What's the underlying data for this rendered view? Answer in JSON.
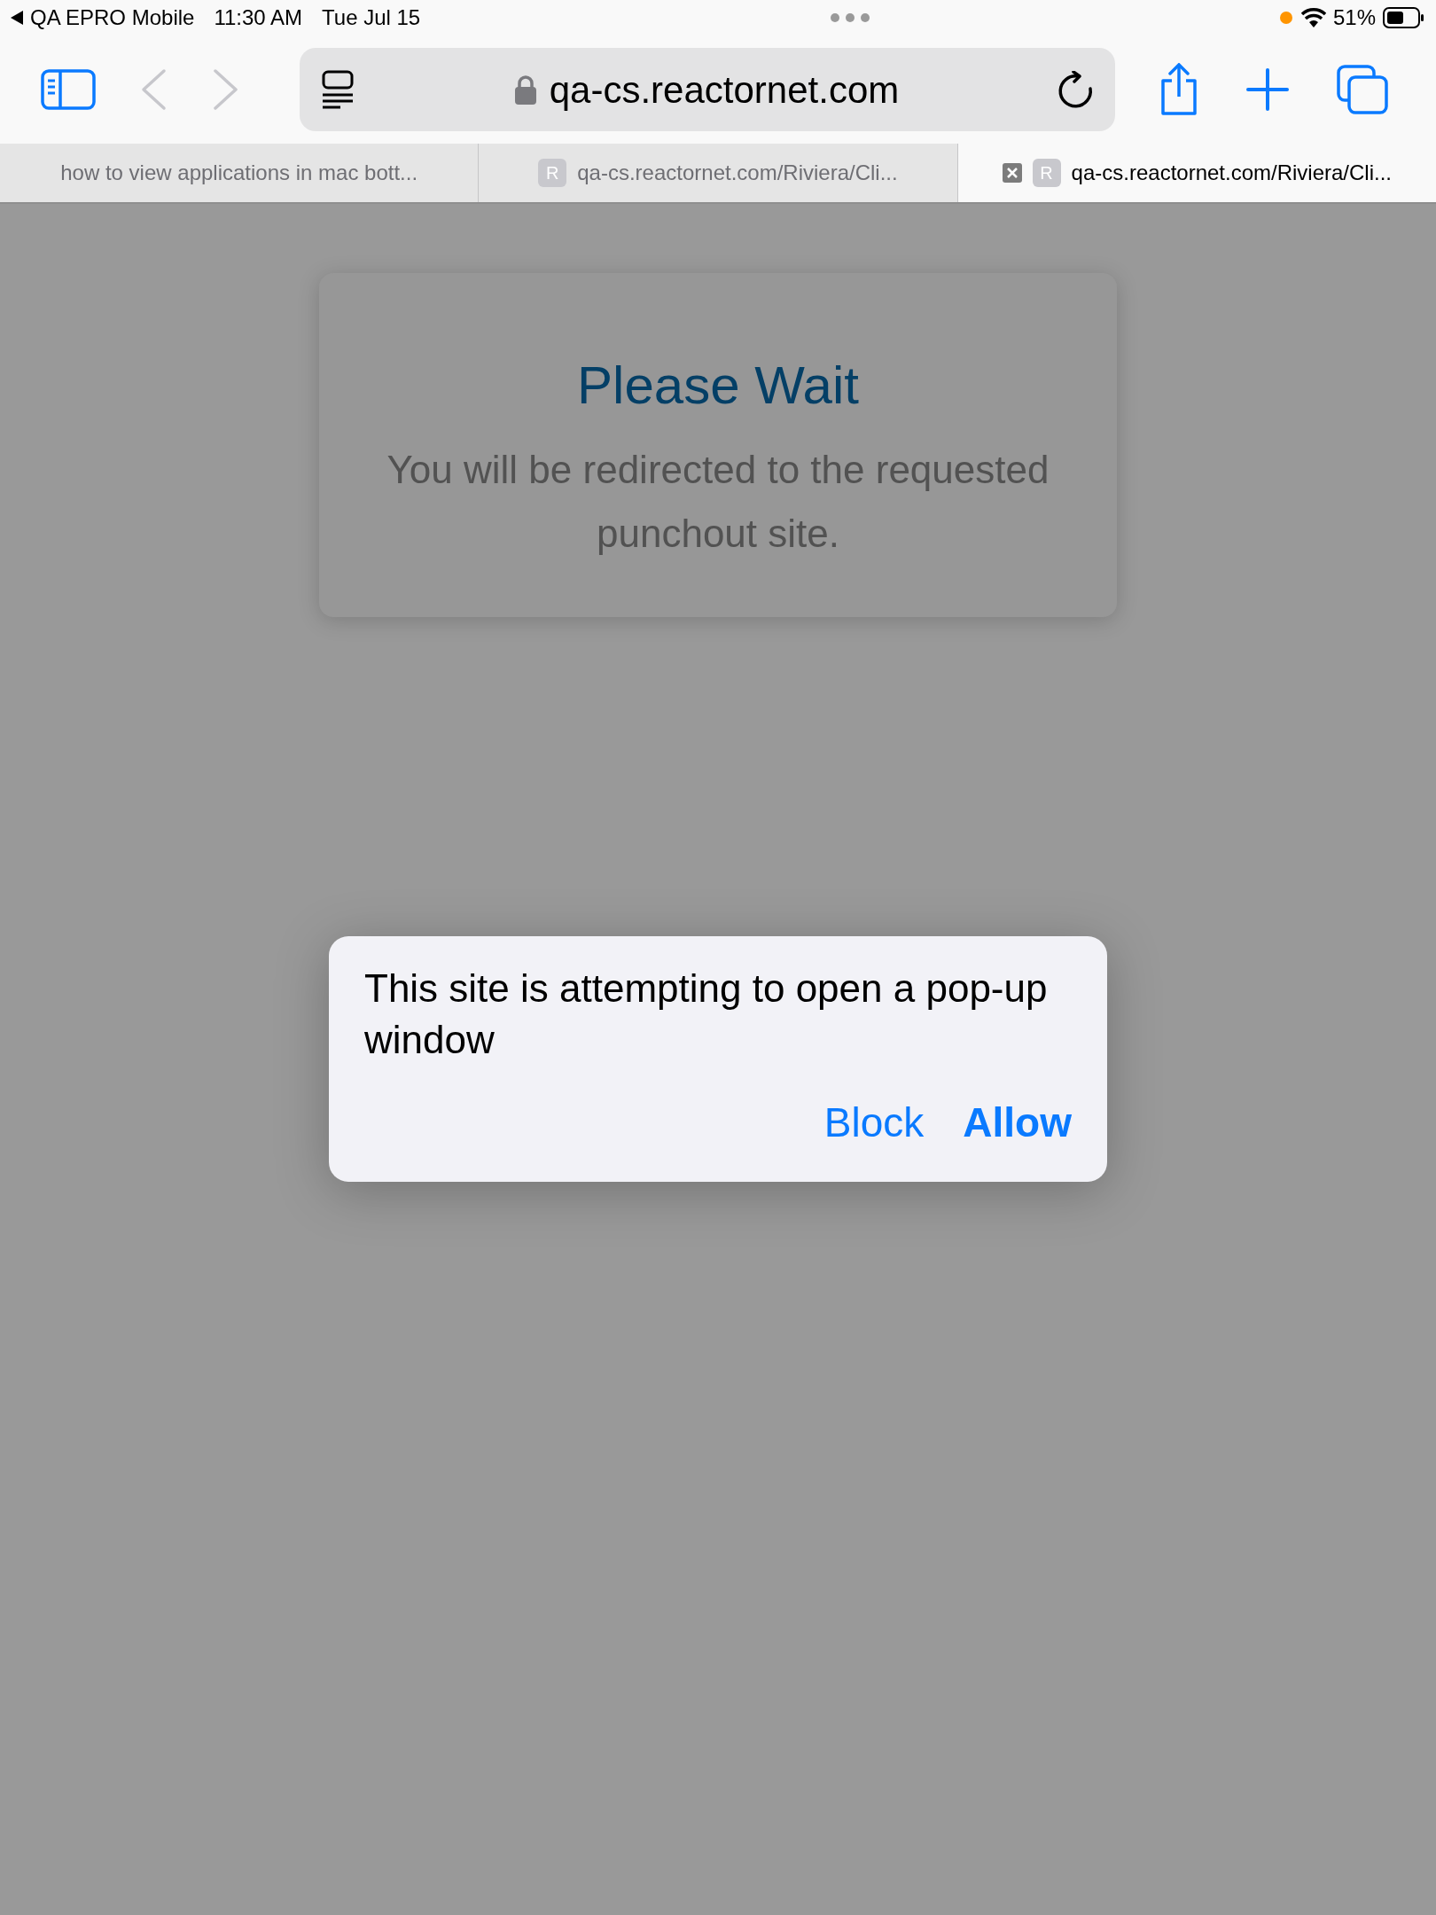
{
  "status_bar": {
    "back_app": "QA EPRO Mobile",
    "time": "11:30 AM",
    "date": "Tue Jul 15",
    "battery": "51%"
  },
  "toolbar": {
    "back": {
      "disabled": true
    },
    "forward": {
      "disabled": true
    },
    "address": "qa-cs.reactornet.com"
  },
  "tabs": [
    {
      "title": "how to view applications in mac bott...",
      "selected": false
    },
    {
      "title": "qa-cs.reactornet.com/Riviera/Cli...",
      "favicon": "R",
      "selected": false
    },
    {
      "title": "qa-cs.reactornet.com/Riviera/Cli...",
      "favicon": "R",
      "selected": true
    }
  ],
  "page": {
    "title": "Please Wait",
    "message": "You will be redirected to the requested punchout site."
  },
  "dialog": {
    "message": "This site is attempting to open a pop-up window",
    "buttons": [
      {
        "label": "Block",
        "preferred": false
      },
      {
        "label": "Allow",
        "preferred": true
      }
    ]
  }
}
